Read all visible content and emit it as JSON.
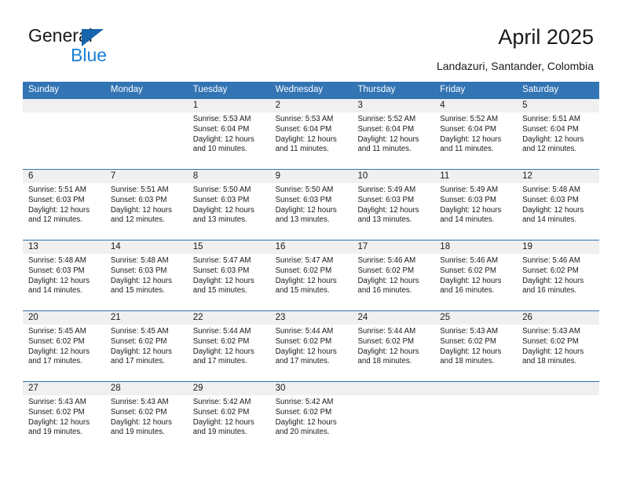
{
  "brand": {
    "name_top": "General",
    "name_bottom": "Blue",
    "accent_color": "#1c7fd4",
    "triangle_color": "#1664ab"
  },
  "header": {
    "title": "April 2025",
    "subtitle": "Landazuri, Santander, Colombia"
  },
  "calendar": {
    "header_bg": "#3274b4",
    "daynum_bg": "#f0f0f0",
    "weekdays": [
      "Sunday",
      "Monday",
      "Tuesday",
      "Wednesday",
      "Thursday",
      "Friday",
      "Saturday"
    ],
    "weeks": [
      [
        {
          "day": "",
          "sunrise": "",
          "sunset": "",
          "daylight_1": "",
          "daylight_2": ""
        },
        {
          "day": "",
          "sunrise": "",
          "sunset": "",
          "daylight_1": "",
          "daylight_2": ""
        },
        {
          "day": "1",
          "sunrise": "Sunrise: 5:53 AM",
          "sunset": "Sunset: 6:04 PM",
          "daylight_1": "Daylight: 12 hours",
          "daylight_2": "and 10 minutes."
        },
        {
          "day": "2",
          "sunrise": "Sunrise: 5:53 AM",
          "sunset": "Sunset: 6:04 PM",
          "daylight_1": "Daylight: 12 hours",
          "daylight_2": "and 11 minutes."
        },
        {
          "day": "3",
          "sunrise": "Sunrise: 5:52 AM",
          "sunset": "Sunset: 6:04 PM",
          "daylight_1": "Daylight: 12 hours",
          "daylight_2": "and 11 minutes."
        },
        {
          "day": "4",
          "sunrise": "Sunrise: 5:52 AM",
          "sunset": "Sunset: 6:04 PM",
          "daylight_1": "Daylight: 12 hours",
          "daylight_2": "and 11 minutes."
        },
        {
          "day": "5",
          "sunrise": "Sunrise: 5:51 AM",
          "sunset": "Sunset: 6:04 PM",
          "daylight_1": "Daylight: 12 hours",
          "daylight_2": "and 12 minutes."
        }
      ],
      [
        {
          "day": "6",
          "sunrise": "Sunrise: 5:51 AM",
          "sunset": "Sunset: 6:03 PM",
          "daylight_1": "Daylight: 12 hours",
          "daylight_2": "and 12 minutes."
        },
        {
          "day": "7",
          "sunrise": "Sunrise: 5:51 AM",
          "sunset": "Sunset: 6:03 PM",
          "daylight_1": "Daylight: 12 hours",
          "daylight_2": "and 12 minutes."
        },
        {
          "day": "8",
          "sunrise": "Sunrise: 5:50 AM",
          "sunset": "Sunset: 6:03 PM",
          "daylight_1": "Daylight: 12 hours",
          "daylight_2": "and 13 minutes."
        },
        {
          "day": "9",
          "sunrise": "Sunrise: 5:50 AM",
          "sunset": "Sunset: 6:03 PM",
          "daylight_1": "Daylight: 12 hours",
          "daylight_2": "and 13 minutes."
        },
        {
          "day": "10",
          "sunrise": "Sunrise: 5:49 AM",
          "sunset": "Sunset: 6:03 PM",
          "daylight_1": "Daylight: 12 hours",
          "daylight_2": "and 13 minutes."
        },
        {
          "day": "11",
          "sunrise": "Sunrise: 5:49 AM",
          "sunset": "Sunset: 6:03 PM",
          "daylight_1": "Daylight: 12 hours",
          "daylight_2": "and 14 minutes."
        },
        {
          "day": "12",
          "sunrise": "Sunrise: 5:48 AM",
          "sunset": "Sunset: 6:03 PM",
          "daylight_1": "Daylight: 12 hours",
          "daylight_2": "and 14 minutes."
        }
      ],
      [
        {
          "day": "13",
          "sunrise": "Sunrise: 5:48 AM",
          "sunset": "Sunset: 6:03 PM",
          "daylight_1": "Daylight: 12 hours",
          "daylight_2": "and 14 minutes."
        },
        {
          "day": "14",
          "sunrise": "Sunrise: 5:48 AM",
          "sunset": "Sunset: 6:03 PM",
          "daylight_1": "Daylight: 12 hours",
          "daylight_2": "and 15 minutes."
        },
        {
          "day": "15",
          "sunrise": "Sunrise: 5:47 AM",
          "sunset": "Sunset: 6:03 PM",
          "daylight_1": "Daylight: 12 hours",
          "daylight_2": "and 15 minutes."
        },
        {
          "day": "16",
          "sunrise": "Sunrise: 5:47 AM",
          "sunset": "Sunset: 6:02 PM",
          "daylight_1": "Daylight: 12 hours",
          "daylight_2": "and 15 minutes."
        },
        {
          "day": "17",
          "sunrise": "Sunrise: 5:46 AM",
          "sunset": "Sunset: 6:02 PM",
          "daylight_1": "Daylight: 12 hours",
          "daylight_2": "and 16 minutes."
        },
        {
          "day": "18",
          "sunrise": "Sunrise: 5:46 AM",
          "sunset": "Sunset: 6:02 PM",
          "daylight_1": "Daylight: 12 hours",
          "daylight_2": "and 16 minutes."
        },
        {
          "day": "19",
          "sunrise": "Sunrise: 5:46 AM",
          "sunset": "Sunset: 6:02 PM",
          "daylight_1": "Daylight: 12 hours",
          "daylight_2": "and 16 minutes."
        }
      ],
      [
        {
          "day": "20",
          "sunrise": "Sunrise: 5:45 AM",
          "sunset": "Sunset: 6:02 PM",
          "daylight_1": "Daylight: 12 hours",
          "daylight_2": "and 17 minutes."
        },
        {
          "day": "21",
          "sunrise": "Sunrise: 5:45 AM",
          "sunset": "Sunset: 6:02 PM",
          "daylight_1": "Daylight: 12 hours",
          "daylight_2": "and 17 minutes."
        },
        {
          "day": "22",
          "sunrise": "Sunrise: 5:44 AM",
          "sunset": "Sunset: 6:02 PM",
          "daylight_1": "Daylight: 12 hours",
          "daylight_2": "and 17 minutes."
        },
        {
          "day": "23",
          "sunrise": "Sunrise: 5:44 AM",
          "sunset": "Sunset: 6:02 PM",
          "daylight_1": "Daylight: 12 hours",
          "daylight_2": "and 17 minutes."
        },
        {
          "day": "24",
          "sunrise": "Sunrise: 5:44 AM",
          "sunset": "Sunset: 6:02 PM",
          "daylight_1": "Daylight: 12 hours",
          "daylight_2": "and 18 minutes."
        },
        {
          "day": "25",
          "sunrise": "Sunrise: 5:43 AM",
          "sunset": "Sunset: 6:02 PM",
          "daylight_1": "Daylight: 12 hours",
          "daylight_2": "and 18 minutes."
        },
        {
          "day": "26",
          "sunrise": "Sunrise: 5:43 AM",
          "sunset": "Sunset: 6:02 PM",
          "daylight_1": "Daylight: 12 hours",
          "daylight_2": "and 18 minutes."
        }
      ],
      [
        {
          "day": "27",
          "sunrise": "Sunrise: 5:43 AM",
          "sunset": "Sunset: 6:02 PM",
          "daylight_1": "Daylight: 12 hours",
          "daylight_2": "and 19 minutes."
        },
        {
          "day": "28",
          "sunrise": "Sunrise: 5:43 AM",
          "sunset": "Sunset: 6:02 PM",
          "daylight_1": "Daylight: 12 hours",
          "daylight_2": "and 19 minutes."
        },
        {
          "day": "29",
          "sunrise": "Sunrise: 5:42 AM",
          "sunset": "Sunset: 6:02 PM",
          "daylight_1": "Daylight: 12 hours",
          "daylight_2": "and 19 minutes."
        },
        {
          "day": "30",
          "sunrise": "Sunrise: 5:42 AM",
          "sunset": "Sunset: 6:02 PM",
          "daylight_1": "Daylight: 12 hours",
          "daylight_2": "and 20 minutes."
        },
        {
          "day": "",
          "sunrise": "",
          "sunset": "",
          "daylight_1": "",
          "daylight_2": ""
        },
        {
          "day": "",
          "sunrise": "",
          "sunset": "",
          "daylight_1": "",
          "daylight_2": ""
        },
        {
          "day": "",
          "sunrise": "",
          "sunset": "",
          "daylight_1": "",
          "daylight_2": ""
        }
      ]
    ]
  }
}
